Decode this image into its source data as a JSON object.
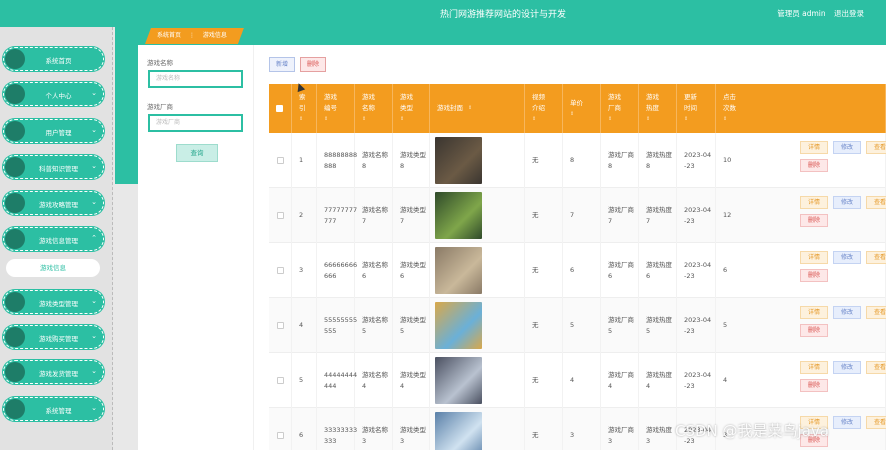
{
  "header": {
    "title": "热门网游推荐网站的设计与开发",
    "admin_label": "管理员 admin",
    "logout": "退出登录"
  },
  "sidebar": {
    "items": [
      {
        "label": "系统首页",
        "chevron": ""
      },
      {
        "label": "个人中心",
        "chevron": "⌄"
      },
      {
        "label": "用户管理",
        "chevron": "⌄"
      },
      {
        "label": "科普知识管理",
        "chevron": "⌄"
      },
      {
        "label": "游戏攻略管理",
        "chevron": "⌄"
      },
      {
        "label": "游戏信息管理",
        "chevron": "⌃"
      },
      {
        "label": "游戏类型管理",
        "chevron": "⌄"
      },
      {
        "label": "游戏购买管理",
        "chevron": "⌄"
      },
      {
        "label": "游戏发货管理",
        "chevron": "⌄"
      },
      {
        "label": "系统管理",
        "chevron": "⌄"
      }
    ],
    "submenu": {
      "label": "游戏信息"
    }
  },
  "breadcrumb": {
    "home": "系统首页",
    "sep": "⋮",
    "current": "游戏信息"
  },
  "search": {
    "name_label": "游戏名称",
    "name_placeholder": "游戏名称",
    "maker_label": "游戏厂商",
    "maker_placeholder": "游戏厂商",
    "query_button": "查询"
  },
  "toolbar": {
    "add": "新增",
    "delete": "删除"
  },
  "table": {
    "sort_glyph": "⇕",
    "columns": [
      "索引",
      "游戏编号",
      "游戏名称",
      "游戏类型",
      "游戏封面",
      "视频介绍",
      "单价",
      "游戏厂商",
      "游戏热度",
      "更新时间",
      "点击次数",
      "操作"
    ],
    "columns_split": [
      [
        "索",
        "引"
      ],
      [
        "游戏",
        "编号"
      ],
      [
        "游戏",
        "名称"
      ],
      [
        "游戏",
        "类型"
      ],
      [
        "游戏封面"
      ],
      [
        "视频",
        "介绍"
      ],
      [
        "单价"
      ],
      [
        "游戏",
        "厂商"
      ],
      [
        "游戏",
        "热度"
      ],
      [
        "更新",
        "时间"
      ],
      [
        "点击",
        "次数"
      ],
      [
        "操作"
      ]
    ],
    "actions": {
      "detail": "详情",
      "edit": "修改",
      "review": "查看评论",
      "remove": "删除"
    },
    "rows": [
      {
        "index": "1",
        "code": [
          "88888888",
          "888"
        ],
        "name": [
          "游戏名称",
          "8"
        ],
        "type": [
          "游戏类型",
          "8"
        ],
        "video": "无",
        "price": "8",
        "maker": [
          "游戏厂商",
          "8"
        ],
        "heat": [
          "游戏热度",
          "8"
        ],
        "date": [
          "2023-04",
          "-23"
        ],
        "clicks": "10",
        "colors": [
          "#3a3530",
          "#6b5a45"
        ]
      },
      {
        "index": "2",
        "code": [
          "77777777",
          "777"
        ],
        "name": [
          "游戏名称",
          "7"
        ],
        "type": [
          "游戏类型",
          "7"
        ],
        "video": "无",
        "price": "7",
        "maker": [
          "游戏厂商",
          "7"
        ],
        "heat": [
          "游戏热度",
          "7"
        ],
        "date": [
          "2023-04",
          "-23"
        ],
        "clicks": "12",
        "colors": [
          "#2f4a2a",
          "#7fa64a"
        ]
      },
      {
        "index": "3",
        "code": [
          "66666666",
          "666"
        ],
        "name": [
          "游戏名称",
          "6"
        ],
        "type": [
          "游戏类型",
          "6"
        ],
        "video": "无",
        "price": "6",
        "maker": [
          "游戏厂商",
          "6"
        ],
        "heat": [
          "游戏热度",
          "6"
        ],
        "date": [
          "2023-04",
          "-23"
        ],
        "clicks": "6",
        "colors": [
          "#8a7a66",
          "#c9b89a"
        ]
      },
      {
        "index": "4",
        "code": [
          "55555555",
          "555"
        ],
        "name": [
          "游戏名称",
          "5"
        ],
        "type": [
          "游戏类型",
          "5"
        ],
        "video": "无",
        "price": "5",
        "maker": [
          "游戏厂商",
          "5"
        ],
        "heat": [
          "游戏热度",
          "5"
        ],
        "date": [
          "2023-04",
          "-23"
        ],
        "clicks": "5",
        "colors": [
          "#d9a84a",
          "#6ab0d8"
        ]
      },
      {
        "index": "5",
        "code": [
          "44444444",
          "444"
        ],
        "name": [
          "游戏名称",
          "4"
        ],
        "type": [
          "游戏类型",
          "4"
        ],
        "video": "无",
        "price": "4",
        "maker": [
          "游戏厂商",
          "4"
        ],
        "heat": [
          "游戏热度",
          "4"
        ],
        "date": [
          "2023-04",
          "-23"
        ],
        "clicks": "4",
        "colors": [
          "#4a5060",
          "#b9c2d0"
        ]
      },
      {
        "index": "6",
        "code": [
          "33333333",
          "333"
        ],
        "name": [
          "游戏名称",
          "3"
        ],
        "type": [
          "游戏类型",
          "3"
        ],
        "video": "无",
        "price": "3",
        "maker": [
          "游戏厂商",
          "3"
        ],
        "heat": [
          "游戏热度",
          "3"
        ],
        "date": [
          "2023-04",
          "-23"
        ],
        "clicks": "3",
        "colors": [
          "#5a80a8",
          "#d0e2f0"
        ]
      }
    ]
  },
  "watermark": "CSDN @我是菜鸟java"
}
